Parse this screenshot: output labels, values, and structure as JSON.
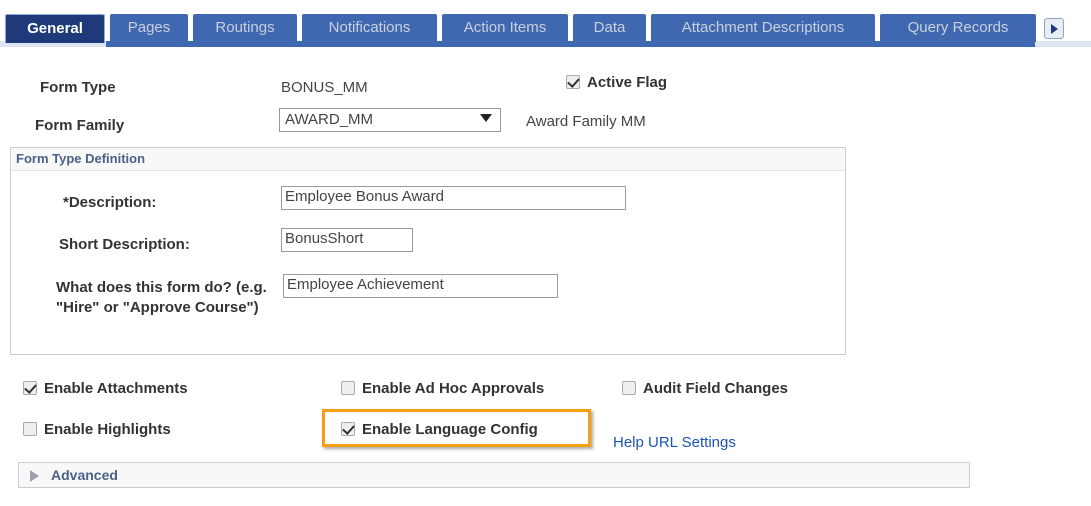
{
  "tabs": {
    "items": [
      {
        "label": "General",
        "active": true
      },
      {
        "label": "Pages",
        "active": false
      },
      {
        "label": "Routings",
        "active": false
      },
      {
        "label": "Notifications",
        "active": false
      },
      {
        "label": "Action Items",
        "active": false
      },
      {
        "label": "Data",
        "active": false
      },
      {
        "label": "Attachment Descriptions",
        "active": false
      },
      {
        "label": "Query Records",
        "active": false
      }
    ],
    "next_icon": "chevron-right-icon"
  },
  "header": {
    "form_type_label": "Form Type",
    "form_type_value": "BONUS_MM",
    "form_family_label": "Form Family",
    "form_family_value": "AWARD_MM",
    "form_family_description": "Award Family MM",
    "active_flag_label": "Active Flag",
    "active_flag_checked": true
  },
  "form_type_definition": {
    "panel_title": "Form Type Definition",
    "description_label": "*Description:",
    "description_value": "Employee Bonus Award",
    "short_description_label": "Short Description:",
    "short_description_value": "BonusShort",
    "what_does_label": "What does this form do? (e.g. \"Hire\" or \"Approve Course\")",
    "what_does_value": "Employee Achievement"
  },
  "options": {
    "enable_attachments_label": "Enable Attachments",
    "enable_attachments_checked": true,
    "enable_highlights_label": "Enable Highlights",
    "enable_highlights_checked": false,
    "enable_adhoc_label": "Enable Ad Hoc Approvals",
    "enable_adhoc_checked": false,
    "audit_field_changes_label": "Audit Field Changes",
    "audit_field_changes_checked": false,
    "enable_language_config_label": "Enable Language Config",
    "enable_language_config_checked": true,
    "help_url_link_label": "Help URL Settings"
  },
  "advanced": {
    "label": "Advanced",
    "expanded": false,
    "toggle_icon": "triangle-right-icon"
  },
  "colors": {
    "tab_active_bg": "#1f3a7a",
    "tab_inactive_bg": "#3f68b0",
    "highlight_border": "#f5a014",
    "link": "#1b55b3",
    "panel_title": "#4a6287"
  }
}
